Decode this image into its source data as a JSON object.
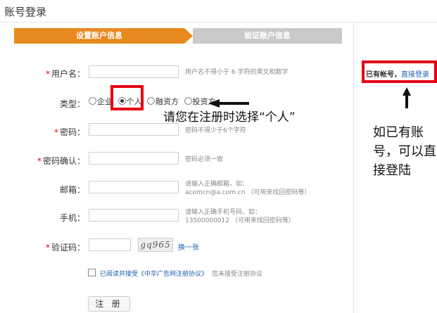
{
  "page": {
    "title": "账号登录"
  },
  "steps": [
    {
      "label": "设置账户信息"
    },
    {
      "label": "验证账户信息"
    }
  ],
  "form": {
    "username": {
      "label": "用户名：",
      "value": "",
      "hint": "用户名不得小于 6 字符的英文和数字"
    },
    "type": {
      "label": "类型：",
      "options": [
        "企业",
        "个人",
        "融资方",
        "投资方"
      ],
      "selected": "个人"
    },
    "password": {
      "label": "密码：",
      "value": "",
      "hint": "密码不得少于6个字符"
    },
    "password_confirm": {
      "label": "密码确认：",
      "value": "",
      "hint": "密码必须一致"
    },
    "email": {
      "label": "邮箱：",
      "value": "",
      "hint_line1": "请输入正确邮箱，如：",
      "hint_line2": "acomcn@a.com.cn （可用来找回密码等）"
    },
    "phone": {
      "label": "手机：",
      "value": "",
      "hint_line1": "请输入正确手机号码，如：",
      "hint_line2": "13500000012 （可用来找回密码等）"
    },
    "captcha": {
      "label": "验证码：",
      "value": "",
      "image_text": "gq965",
      "refresh_label": "换一张"
    },
    "agreement": {
      "label": "已阅读并接受《中华广告网注册协议》",
      "note": "您未接受注册协议",
      "checked": false
    },
    "submit_label": "注 册"
  },
  "side": {
    "prompt": "已有帐号，",
    "link": "直接登录"
  },
  "annotations": {
    "select_personal": "请您在注册时选择“个人”",
    "login_hint": "如已有账\n号，可以直\n接登陆"
  },
  "colors": {
    "accent": "#e8891f",
    "inactive_step": "#c9c9c9",
    "highlight": "#e60012",
    "link": "#1a5fb4"
  }
}
